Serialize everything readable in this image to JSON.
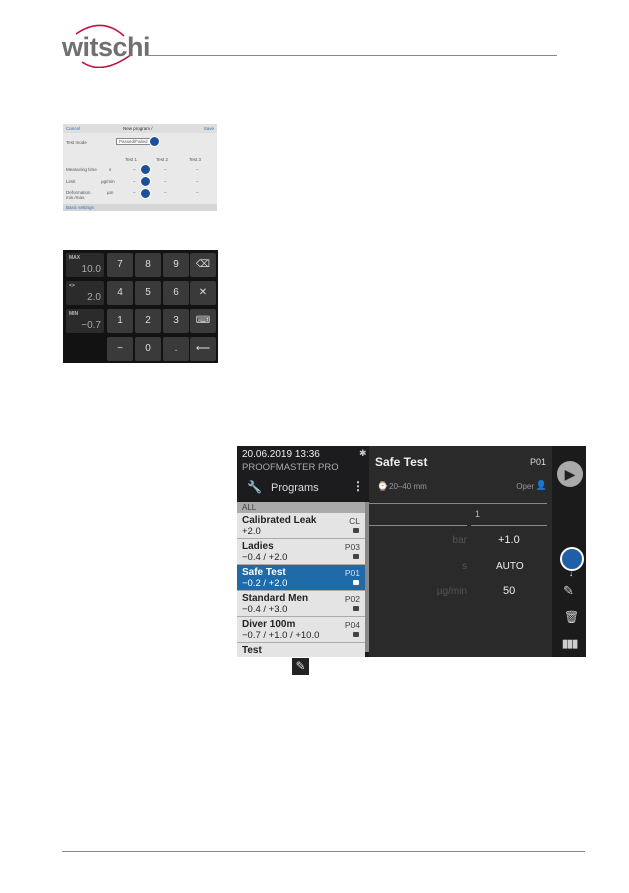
{
  "header": {
    "logo": "witschi"
  },
  "screen_new_program": {
    "cancel": "Cancel",
    "title": "New program /",
    "save": "Save",
    "test_mode_label": "Test mode",
    "test_mode_value": "Passed/Failed",
    "columns": [
      "Test 1",
      "Test 2",
      "Test 3"
    ],
    "rows": [
      {
        "label": "Measuring time",
        "unit": "s",
        "values": [
          "–",
          "–",
          "–"
        ]
      },
      {
        "label": "Limit",
        "unit": "µg/min",
        "values": [
          "–",
          "–",
          "–"
        ]
      },
      {
        "label": "Deformation",
        "sub": "min./max.",
        "unit": "µm",
        "values": [
          "–",
          "–",
          "–"
        ]
      }
    ],
    "back": "Basic settings"
  },
  "keypad": {
    "displays": [
      {
        "label": "MAX",
        "value": "10.0"
      },
      {
        "label": "<>",
        "value": "2.0"
      },
      {
        "label": "MIN",
        "value": "−0.7"
      }
    ],
    "keys": [
      "7",
      "8",
      "9",
      "4",
      "5",
      "6",
      "1",
      "2",
      "3",
      "−",
      "0",
      "."
    ],
    "icons": [
      "backspace-icon",
      "clear-icon",
      "keyboard-icon",
      "enter-icon"
    ]
  },
  "device": {
    "datetime": "20.06.2019 13:36",
    "model": "PROOFMASTER PRO",
    "menu_title": "Programs",
    "filter": "ALL",
    "programs": [
      {
        "name": "Calibrated Leak",
        "values": "+2.0",
        "code": "CL",
        "selected": false
      },
      {
        "name": "Ladies",
        "values": "−0.4 / +2.0",
        "code": "P03",
        "selected": false
      },
      {
        "name": "Safe Test",
        "values": "−0.2 / +2.0",
        "code": "P01",
        "selected": true
      },
      {
        "name": "Standard Men",
        "values": "−0.4 / +3.0",
        "code": "P02",
        "selected": false
      },
      {
        "name": "Diver 100m",
        "values": "−0.7 / +1.0 / +10.0",
        "code": "P04",
        "selected": false
      },
      {
        "name": "Test",
        "values": "",
        "code": "",
        "selected": false
      }
    ],
    "detail": {
      "title": "Safe Test",
      "code": "P01",
      "size": "20–40 mm",
      "operator": "Oper",
      "column": "1",
      "params": [
        {
          "unit": "bar",
          "value": "+1.0"
        },
        {
          "unit": "s",
          "value": "AUTO"
        },
        {
          "unit": "µg/min",
          "value": "50"
        }
      ]
    },
    "accent": "#1f6aa8"
  }
}
